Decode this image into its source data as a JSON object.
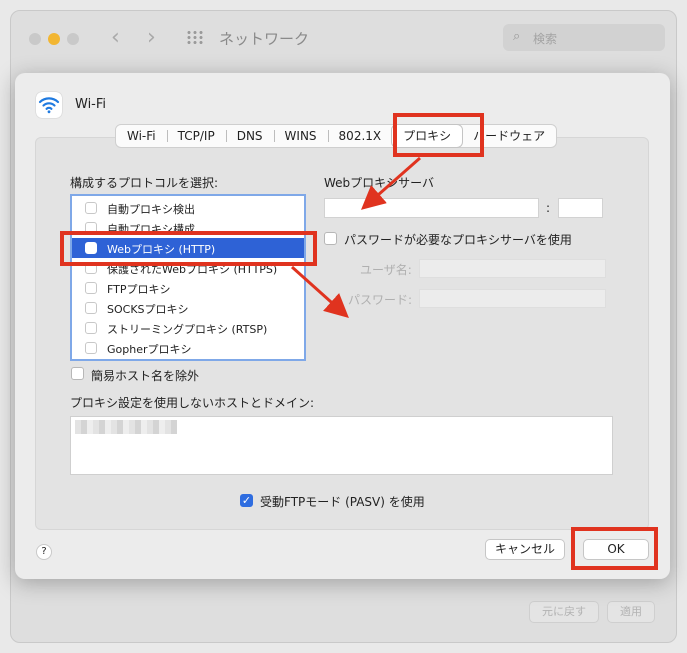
{
  "window": {
    "title": "ネットワーク",
    "search_placeholder": "検索",
    "revert_label": "元に戻す",
    "apply_label": "適用"
  },
  "sheet": {
    "interface_name": "Wi-Fi",
    "tabs": [
      {
        "label": "Wi-Fi"
      },
      {
        "label": "TCP/IP"
      },
      {
        "label": "DNS"
      },
      {
        "label": "WINS"
      },
      {
        "label": "802.1X"
      },
      {
        "label": "プロキシ",
        "active": true
      },
      {
        "label": "ハードウェア"
      }
    ],
    "protocol_heading": "構成するプロトコルを選択:",
    "protocols": [
      {
        "label": "自動プロキシ検出",
        "checked": false
      },
      {
        "label": "自動プロキシ構成",
        "checked": false
      },
      {
        "label": "Webプロキシ (HTTP)",
        "checked": false,
        "selected": true
      },
      {
        "label": "保護されたWebプロキシ (HTTPS)",
        "checked": false
      },
      {
        "label": "FTPプロキシ",
        "checked": false
      },
      {
        "label": "SOCKSプロキシ",
        "checked": false
      },
      {
        "label": "ストリーミングプロキシ (RTSP)",
        "checked": false
      },
      {
        "label": "Gopherプロキシ",
        "checked": false
      }
    ],
    "web_proxy_server_label": "Webプロキシサーバ",
    "server_value": "",
    "port_separator": ":",
    "port_value": "",
    "password_required_label": "パスワードが必要なプロキシサーバを使用",
    "username_label": "ユーザ名:",
    "password_label": "パスワード:",
    "exclude_simple_hostnames_label": "簡易ホスト名を除外",
    "bypass_label": "プロキシ設定を使用しないホストとドメイン:",
    "passive_ftp_label": "受動FTPモード (PASV) を使用",
    "passive_ftp_checked": true,
    "help_label": "?",
    "cancel_label": "キャンセル",
    "ok_label": "OK"
  },
  "colors": {
    "annotation_red": "#e0331f",
    "selection_blue": "#2e62d6",
    "list_border": "#7fa8e8"
  }
}
